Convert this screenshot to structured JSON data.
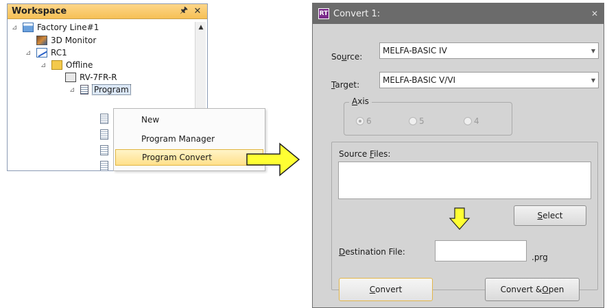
{
  "workspace": {
    "title": "Workspace",
    "pin_glyph": "Ȅ",
    "close_glyph": "✕",
    "tree": {
      "factory": "Factory Line#1",
      "monitor": "3D Monitor",
      "rc": "RC1",
      "offline": "Offline",
      "robot": "RV-7FR-R",
      "program": "Program"
    }
  },
  "context_menu": {
    "items": [
      "New",
      "Program Manager",
      "Program Convert"
    ],
    "highlighted": "Program Convert"
  },
  "arrow_color": "#ffff33",
  "dialog": {
    "title": "Convert 1:",
    "source_label_a": "So",
    "source_label_u": "u",
    "source_label_b": "rce:",
    "source_value": "MELFA-BASIC IV",
    "target_label_u": "T",
    "target_label_b": "arget:",
    "target_value": "MELFA-BASIC V/VI",
    "axis_label_u": "A",
    "axis_label_b": "xis",
    "axis_options": [
      "6",
      "5",
      "4"
    ],
    "axis_selected": "6",
    "source_files_label_a": "Source ",
    "source_files_label_u": "F",
    "source_files_label_b": "iles:",
    "select_u": "S",
    "select_b": "elect",
    "destination_label_u": "D",
    "destination_label_b": "estination File:",
    "destination_value": "",
    "extension": ".prg",
    "convert_u": "C",
    "convert_b": "onvert",
    "convert_open_a": "Convert & ",
    "convert_open_u": "O",
    "convert_open_b": "pen",
    "close_glyph": "✕"
  }
}
